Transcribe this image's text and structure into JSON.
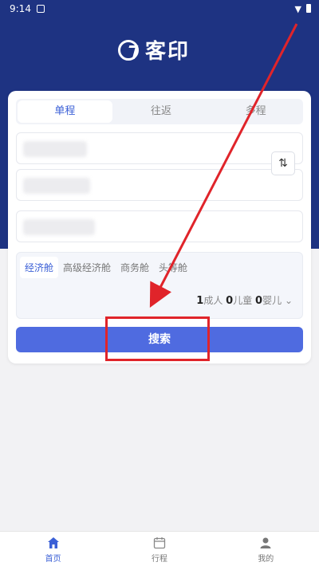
{
  "status_bar": {
    "time": "9:14"
  },
  "header": {
    "brand": "客印"
  },
  "trip_tabs": [
    {
      "label": "单程",
      "active": true
    },
    {
      "label": "往返",
      "active": false
    },
    {
      "label": "多程",
      "active": false
    }
  ],
  "cabin_classes": [
    {
      "label": "经济舱",
      "active": true
    },
    {
      "label": "高级经济舱",
      "active": false
    },
    {
      "label": "商务舱",
      "active": false
    },
    {
      "label": "头等舱",
      "active": false
    }
  ],
  "passengers": {
    "adult_count": "1",
    "adult_label": "成人",
    "child_count": "0",
    "child_label": "儿童",
    "infant_count": "0",
    "infant_label": "婴儿"
  },
  "search_button": "搜索",
  "bottom_nav": [
    {
      "label": "首页",
      "icon": "home-icon",
      "active": true
    },
    {
      "label": "行程",
      "icon": "calendar-icon",
      "active": false
    },
    {
      "label": "我的",
      "icon": "person-icon",
      "active": false
    }
  ],
  "colors": {
    "header": "#1e3382",
    "accent": "#4f6be0",
    "annotation": "#e0242a"
  }
}
